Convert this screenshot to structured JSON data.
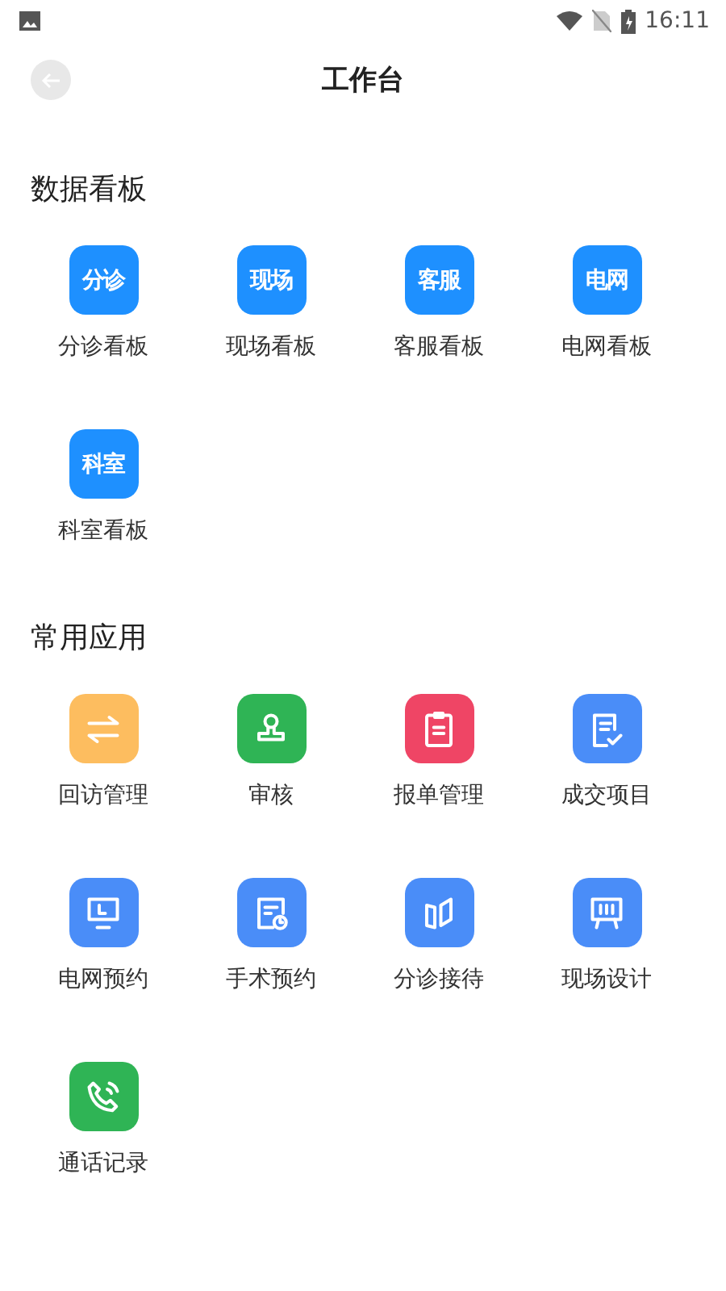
{
  "status_bar": {
    "time": "16:11"
  },
  "header": {
    "title": "工作台"
  },
  "sections": [
    {
      "title": "数据看板",
      "items": [
        {
          "kind": "text",
          "badge": "分诊",
          "label": "分诊看板",
          "color": "#1e90ff"
        },
        {
          "kind": "text",
          "badge": "现场",
          "label": "现场看板",
          "color": "#1e90ff"
        },
        {
          "kind": "text",
          "badge": "客服",
          "label": "客服看板",
          "color": "#1e90ff"
        },
        {
          "kind": "text",
          "badge": "电网",
          "label": "电网看板",
          "color": "#1e90ff"
        },
        {
          "kind": "text",
          "badge": "科室",
          "label": "科室看板",
          "color": "#1e90ff"
        }
      ]
    },
    {
      "title": "常用应用",
      "items": [
        {
          "kind": "glyph",
          "label": "回访管理",
          "color": "#fdbd5f"
        },
        {
          "kind": "glyph",
          "label": "审核",
          "color": "#2fb455"
        },
        {
          "kind": "glyph",
          "label": "报单管理",
          "color": "#ef4565"
        },
        {
          "kind": "glyph",
          "label": "成交项目",
          "color": "#4a8df8"
        },
        {
          "kind": "glyph",
          "label": "电网预约",
          "color": "#4a8df8"
        },
        {
          "kind": "glyph",
          "label": "手术预约",
          "color": "#4a8df8"
        },
        {
          "kind": "glyph",
          "label": "分诊接待",
          "color": "#4a8df8"
        },
        {
          "kind": "glyph",
          "label": "现场设计",
          "color": "#4a8df8"
        },
        {
          "kind": "glyph",
          "label": "通话记录",
          "color": "#2fb455"
        }
      ]
    }
  ]
}
